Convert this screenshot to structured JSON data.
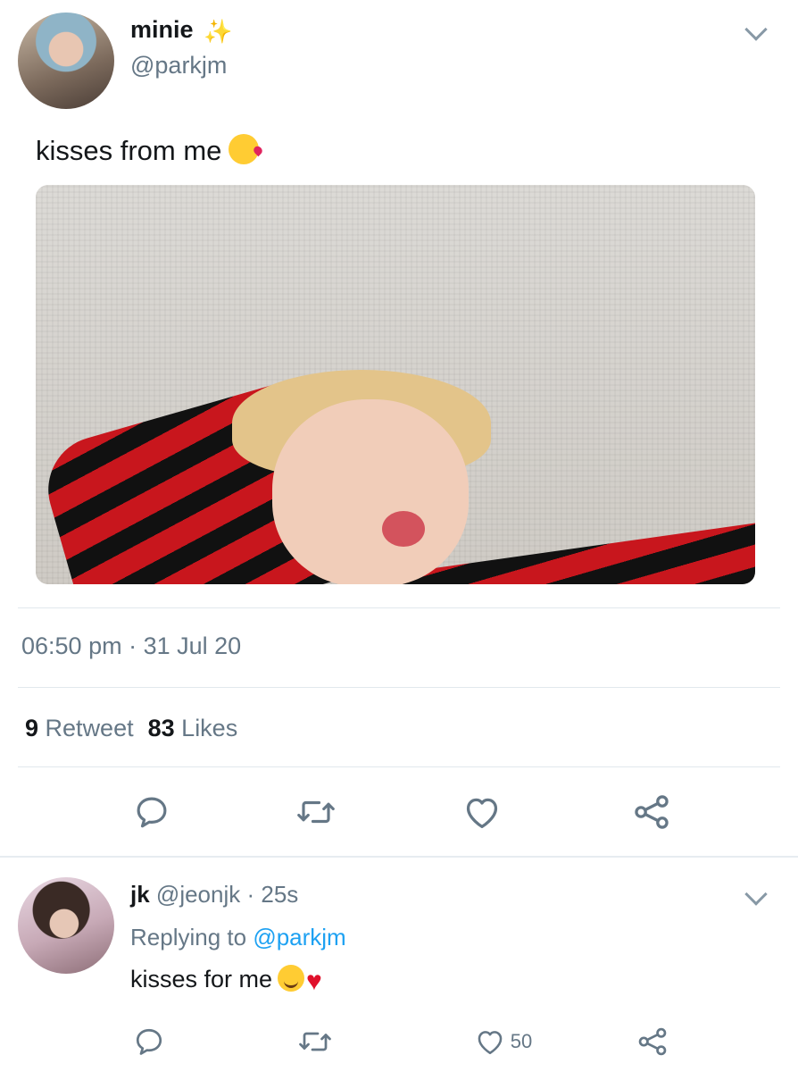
{
  "tweet": {
    "display_name": "minie",
    "handle": "@parkjm",
    "text": "kisses from me",
    "timestamp": "06:50 pm · 31 Jul 20",
    "retweets_count": "9",
    "retweets_label": "Retweet",
    "likes_count": "83",
    "likes_label": "Likes",
    "icons": [
      "sparkle-icon",
      "kissing-face-emoji",
      "chevron-down-icon",
      "reply-icon",
      "retweet-icon",
      "like-icon",
      "share-icon"
    ]
  },
  "reply": {
    "display_name": "jk",
    "handle": "@jeonjk",
    "time": "25s",
    "replying_prefix": "Replying to",
    "replying_to": "@parkjm",
    "text": "kisses for me",
    "like_count": "50"
  },
  "colors": {
    "link": "#1da1f2",
    "secondary_text": "#657786",
    "icon": "#657786",
    "divider": "#e1e8ed"
  }
}
